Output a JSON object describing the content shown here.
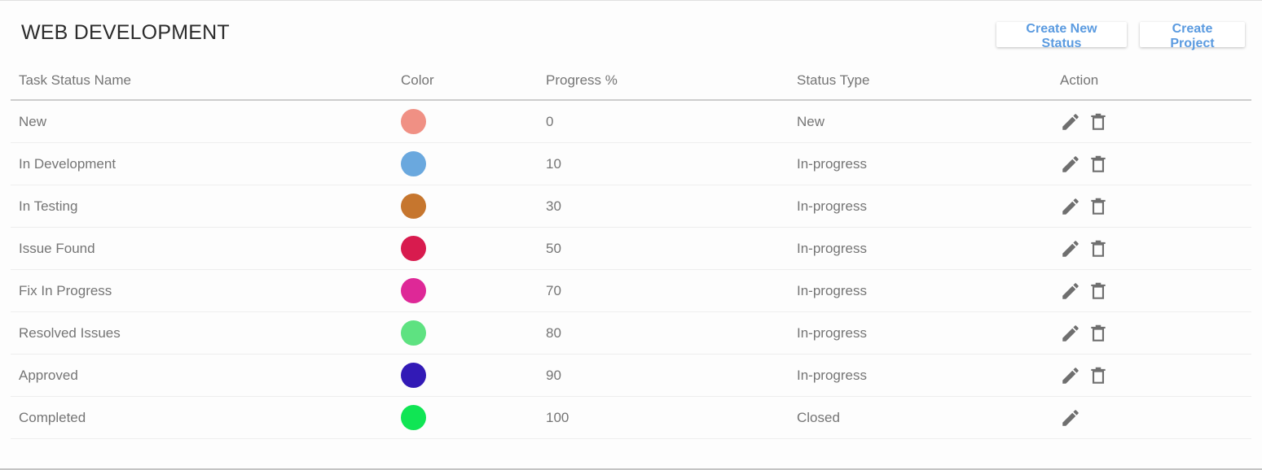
{
  "page": {
    "title": "WEB DEVELOPMENT",
    "buttons": {
      "create_status": "Create New Status",
      "create_project": "Create Project"
    }
  },
  "table": {
    "headers": [
      "Task Status Name",
      "Color",
      "Progress %",
      "Status Type",
      "Action"
    ],
    "rows": [
      {
        "name": "New",
        "color": "#f09084",
        "progress": "0",
        "type": "New",
        "deletable": true
      },
      {
        "name": "In Development",
        "color": "#6aa8de",
        "progress": "10",
        "type": "In-progress",
        "deletable": true
      },
      {
        "name": "In Testing",
        "color": "#c6762e",
        "progress": "30",
        "type": "In-progress",
        "deletable": true
      },
      {
        "name": "Issue Found",
        "color": "#d81b4e",
        "progress": "50",
        "type": "In-progress",
        "deletable": true
      },
      {
        "name": "Fix In Progress",
        "color": "#de2897",
        "progress": "70",
        "type": "In-progress",
        "deletable": true
      },
      {
        "name": "Resolved Issues",
        "color": "#5ee281",
        "progress": "80",
        "type": "In-progress",
        "deletable": true
      },
      {
        "name": "Approved",
        "color": "#321ab6",
        "progress": "90",
        "type": "In-progress",
        "deletable": true
      },
      {
        "name": "Completed",
        "color": "#10e554",
        "progress": "100",
        "type": "Closed",
        "deletable": false
      }
    ],
    "icons": {
      "edit": "pencil-icon",
      "delete": "trash-icon"
    }
  }
}
